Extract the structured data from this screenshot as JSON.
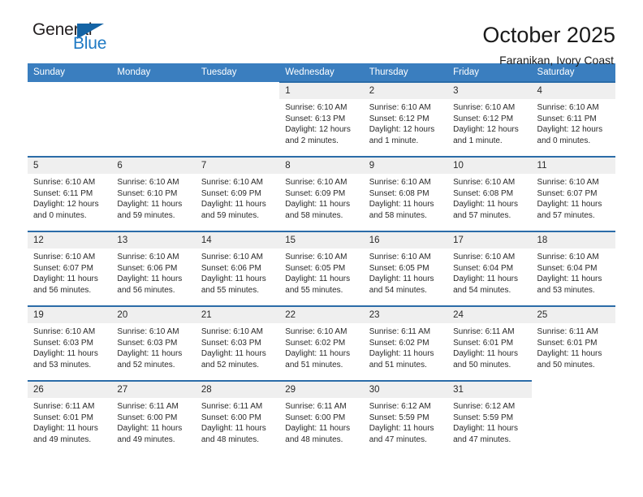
{
  "brand": {
    "name_top": "General",
    "name_bottom": "Blue",
    "accent_color": "#1464a5",
    "text_color": "#231f20"
  },
  "header": {
    "title": "October 2025",
    "subtitle": "Faranikan, Ivory Coast"
  },
  "calendar": {
    "header_bg": "#3a7ebf",
    "cell_border": "#2b6ca8",
    "daynum_bg": "#efefef",
    "weekdays": [
      "Sunday",
      "Monday",
      "Tuesday",
      "Wednesday",
      "Thursday",
      "Friday",
      "Saturday"
    ],
    "weeks": [
      [
        {
          "day": "",
          "empty": true
        },
        {
          "day": "",
          "empty": true
        },
        {
          "day": "",
          "empty": true
        },
        {
          "day": "1",
          "sunrise": "Sunrise: 6:10 AM",
          "sunset": "Sunset: 6:13 PM",
          "daylight_line1": "Daylight: 12 hours",
          "daylight_line2": "and 2 minutes."
        },
        {
          "day": "2",
          "sunrise": "Sunrise: 6:10 AM",
          "sunset": "Sunset: 6:12 PM",
          "daylight_line1": "Daylight: 12 hours",
          "daylight_line2": "and 1 minute."
        },
        {
          "day": "3",
          "sunrise": "Sunrise: 6:10 AM",
          "sunset": "Sunset: 6:12 PM",
          "daylight_line1": "Daylight: 12 hours",
          "daylight_line2": "and 1 minute."
        },
        {
          "day": "4",
          "sunrise": "Sunrise: 6:10 AM",
          "sunset": "Sunset: 6:11 PM",
          "daylight_line1": "Daylight: 12 hours",
          "daylight_line2": "and 0 minutes."
        }
      ],
      [
        {
          "day": "5",
          "sunrise": "Sunrise: 6:10 AM",
          "sunset": "Sunset: 6:11 PM",
          "daylight_line1": "Daylight: 12 hours",
          "daylight_line2": "and 0 minutes."
        },
        {
          "day": "6",
          "sunrise": "Sunrise: 6:10 AM",
          "sunset": "Sunset: 6:10 PM",
          "daylight_line1": "Daylight: 11 hours",
          "daylight_line2": "and 59 minutes."
        },
        {
          "day": "7",
          "sunrise": "Sunrise: 6:10 AM",
          "sunset": "Sunset: 6:09 PM",
          "daylight_line1": "Daylight: 11 hours",
          "daylight_line2": "and 59 minutes."
        },
        {
          "day": "8",
          "sunrise": "Sunrise: 6:10 AM",
          "sunset": "Sunset: 6:09 PM",
          "daylight_line1": "Daylight: 11 hours",
          "daylight_line2": "and 58 minutes."
        },
        {
          "day": "9",
          "sunrise": "Sunrise: 6:10 AM",
          "sunset": "Sunset: 6:08 PM",
          "daylight_line1": "Daylight: 11 hours",
          "daylight_line2": "and 58 minutes."
        },
        {
          "day": "10",
          "sunrise": "Sunrise: 6:10 AM",
          "sunset": "Sunset: 6:08 PM",
          "daylight_line1": "Daylight: 11 hours",
          "daylight_line2": "and 57 minutes."
        },
        {
          "day": "11",
          "sunrise": "Sunrise: 6:10 AM",
          "sunset": "Sunset: 6:07 PM",
          "daylight_line1": "Daylight: 11 hours",
          "daylight_line2": "and 57 minutes."
        }
      ],
      [
        {
          "day": "12",
          "sunrise": "Sunrise: 6:10 AM",
          "sunset": "Sunset: 6:07 PM",
          "daylight_line1": "Daylight: 11 hours",
          "daylight_line2": "and 56 minutes."
        },
        {
          "day": "13",
          "sunrise": "Sunrise: 6:10 AM",
          "sunset": "Sunset: 6:06 PM",
          "daylight_line1": "Daylight: 11 hours",
          "daylight_line2": "and 56 minutes."
        },
        {
          "day": "14",
          "sunrise": "Sunrise: 6:10 AM",
          "sunset": "Sunset: 6:06 PM",
          "daylight_line1": "Daylight: 11 hours",
          "daylight_line2": "and 55 minutes."
        },
        {
          "day": "15",
          "sunrise": "Sunrise: 6:10 AM",
          "sunset": "Sunset: 6:05 PM",
          "daylight_line1": "Daylight: 11 hours",
          "daylight_line2": "and 55 minutes."
        },
        {
          "day": "16",
          "sunrise": "Sunrise: 6:10 AM",
          "sunset": "Sunset: 6:05 PM",
          "daylight_line1": "Daylight: 11 hours",
          "daylight_line2": "and 54 minutes."
        },
        {
          "day": "17",
          "sunrise": "Sunrise: 6:10 AM",
          "sunset": "Sunset: 6:04 PM",
          "daylight_line1": "Daylight: 11 hours",
          "daylight_line2": "and 54 minutes."
        },
        {
          "day": "18",
          "sunrise": "Sunrise: 6:10 AM",
          "sunset": "Sunset: 6:04 PM",
          "daylight_line1": "Daylight: 11 hours",
          "daylight_line2": "and 53 minutes."
        }
      ],
      [
        {
          "day": "19",
          "sunrise": "Sunrise: 6:10 AM",
          "sunset": "Sunset: 6:03 PM",
          "daylight_line1": "Daylight: 11 hours",
          "daylight_line2": "and 53 minutes."
        },
        {
          "day": "20",
          "sunrise": "Sunrise: 6:10 AM",
          "sunset": "Sunset: 6:03 PM",
          "daylight_line1": "Daylight: 11 hours",
          "daylight_line2": "and 52 minutes."
        },
        {
          "day": "21",
          "sunrise": "Sunrise: 6:10 AM",
          "sunset": "Sunset: 6:03 PM",
          "daylight_line1": "Daylight: 11 hours",
          "daylight_line2": "and 52 minutes."
        },
        {
          "day": "22",
          "sunrise": "Sunrise: 6:10 AM",
          "sunset": "Sunset: 6:02 PM",
          "daylight_line1": "Daylight: 11 hours",
          "daylight_line2": "and 51 minutes."
        },
        {
          "day": "23",
          "sunrise": "Sunrise: 6:11 AM",
          "sunset": "Sunset: 6:02 PM",
          "daylight_line1": "Daylight: 11 hours",
          "daylight_line2": "and 51 minutes."
        },
        {
          "day": "24",
          "sunrise": "Sunrise: 6:11 AM",
          "sunset": "Sunset: 6:01 PM",
          "daylight_line1": "Daylight: 11 hours",
          "daylight_line2": "and 50 minutes."
        },
        {
          "day": "25",
          "sunrise": "Sunrise: 6:11 AM",
          "sunset": "Sunset: 6:01 PM",
          "daylight_line1": "Daylight: 11 hours",
          "daylight_line2": "and 50 minutes."
        }
      ],
      [
        {
          "day": "26",
          "sunrise": "Sunrise: 6:11 AM",
          "sunset": "Sunset: 6:01 PM",
          "daylight_line1": "Daylight: 11 hours",
          "daylight_line2": "and 49 minutes."
        },
        {
          "day": "27",
          "sunrise": "Sunrise: 6:11 AM",
          "sunset": "Sunset: 6:00 PM",
          "daylight_line1": "Daylight: 11 hours",
          "daylight_line2": "and 49 minutes."
        },
        {
          "day": "28",
          "sunrise": "Sunrise: 6:11 AM",
          "sunset": "Sunset: 6:00 PM",
          "daylight_line1": "Daylight: 11 hours",
          "daylight_line2": "and 48 minutes."
        },
        {
          "day": "29",
          "sunrise": "Sunrise: 6:11 AM",
          "sunset": "Sunset: 6:00 PM",
          "daylight_line1": "Daylight: 11 hours",
          "daylight_line2": "and 48 minutes."
        },
        {
          "day": "30",
          "sunrise": "Sunrise: 6:12 AM",
          "sunset": "Sunset: 5:59 PM",
          "daylight_line1": "Daylight: 11 hours",
          "daylight_line2": "and 47 minutes."
        },
        {
          "day": "31",
          "sunrise": "Sunrise: 6:12 AM",
          "sunset": "Sunset: 5:59 PM",
          "daylight_line1": "Daylight: 11 hours",
          "daylight_line2": "and 47 minutes."
        },
        {
          "day": "",
          "empty": true
        }
      ]
    ]
  }
}
